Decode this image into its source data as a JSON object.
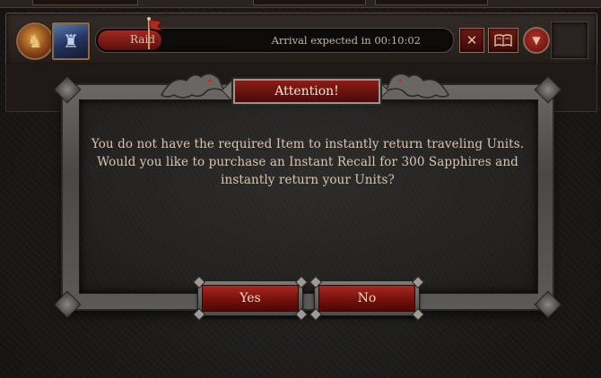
{
  "queue": {
    "mission_label": "Raid",
    "arrival_text": "Arrival expected in 00:10:02",
    "progress_fraction": 0.18,
    "cancel_icon": "close-x",
    "report_icon": "scroll-book",
    "expand_icon": "chevron-down"
  },
  "dialog": {
    "title": "Attention!",
    "message": "You do not have the required Item to instantly return traveling Units. Would you like to purchase an Instant Recall for 300 Sapphires and instantly return your Units?",
    "yes_label": "Yes",
    "no_label": "No"
  },
  "colors": {
    "accent_red": "#8a1e18",
    "frame_gray": "#6b6866",
    "text_parchment": "#d6c6b2"
  }
}
